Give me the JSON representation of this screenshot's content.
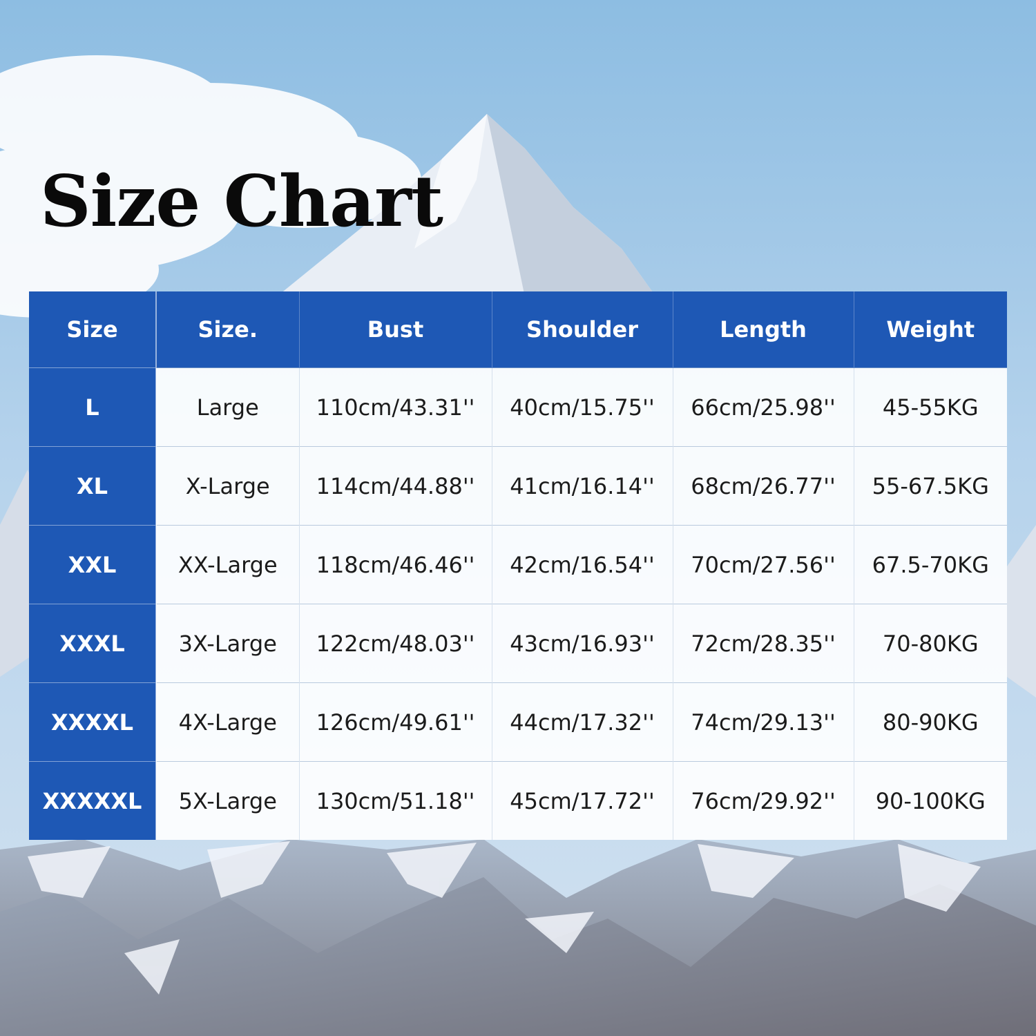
{
  "title": "Size Chart",
  "colors": {
    "header_blue": "#1e58b5",
    "sky_top": "#93c1e3",
    "sky_bottom": "#c7dcef",
    "title_text": "#0a0a0a"
  },
  "table": {
    "headers": [
      "Size",
      "Size.",
      "Bust",
      "Shoulder",
      "Length",
      "Weight"
    ],
    "rows": [
      [
        "L",
        "Large",
        "110cm/43.31''",
        "40cm/15.75''",
        "66cm/25.98''",
        "45-55KG"
      ],
      [
        "XL",
        "X-Large",
        "114cm/44.88''",
        "41cm/16.14''",
        "68cm/26.77''",
        "55-67.5KG"
      ],
      [
        "XXL",
        "XX-Large",
        "118cm/46.46''",
        "42cm/16.54''",
        "70cm/27.56''",
        "67.5-70KG"
      ],
      [
        "XXXL",
        "3X-Large",
        "122cm/48.03''",
        "43cm/16.93''",
        "72cm/28.35''",
        "70-80KG"
      ],
      [
        "XXXXL",
        "4X-Large",
        "126cm/49.61''",
        "44cm/17.32''",
        "74cm/29.13''",
        "80-90KG"
      ],
      [
        "XXXXXL",
        "5X-Large",
        "130cm/51.18''",
        "45cm/17.72''",
        "76cm/29.92''",
        "90-100KG"
      ]
    ]
  }
}
